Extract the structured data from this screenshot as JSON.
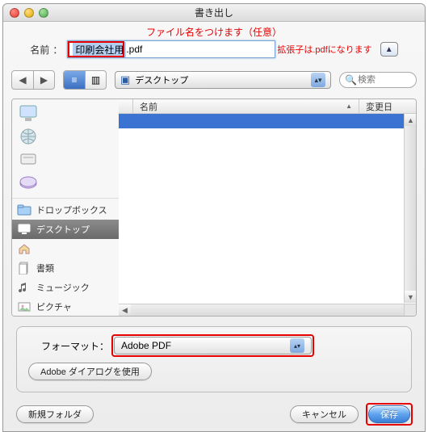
{
  "window": {
    "title": "書き出し"
  },
  "annotations": {
    "top": "ファイル名をつけます（任意）",
    "ext": "拡張子は.pdfになります"
  },
  "name_field": {
    "label": "名前",
    "editable_part": "印刷会社用",
    "extension": ".pdf"
  },
  "path_popup": {
    "label": "デスクトップ"
  },
  "search": {
    "placeholder": "検索"
  },
  "sidebar": {
    "folders": [
      {
        "label": "ドロップボックス"
      },
      {
        "label": "デスクトップ"
      },
      {
        "label": "書類"
      },
      {
        "label": "ミュージック"
      },
      {
        "label": "ピクチャ"
      }
    ]
  },
  "list": {
    "col_name": "名前",
    "col_mod": "変更日"
  },
  "format": {
    "label": "フォーマット",
    "value": "Adobe PDF",
    "use_dialog": "Adobe ダイアログを使用"
  },
  "buttons": {
    "new_folder": "新規フォルダ",
    "cancel": "キャンセル",
    "save": "保存"
  }
}
